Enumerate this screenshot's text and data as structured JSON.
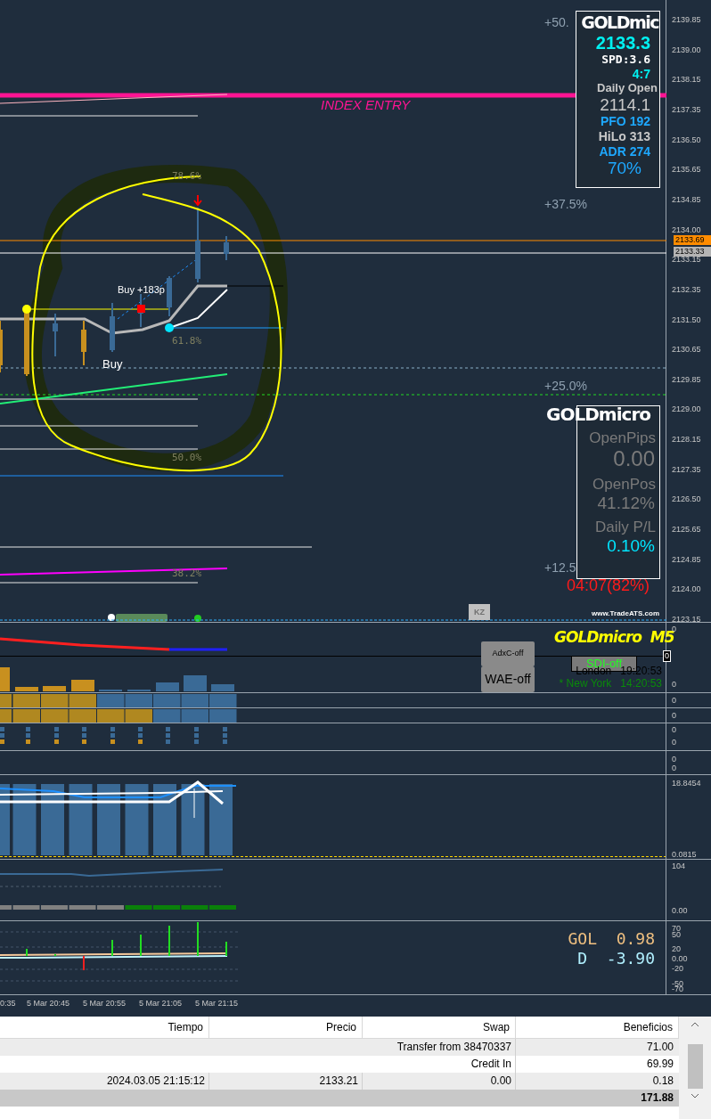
{
  "main_chart": {
    "fib_labels": [
      "+50.",
      "+37.5%",
      "+25.0%",
      "+12.5"
    ],
    "level_labels": [
      "78.6%",
      "61.8%",
      "50.0%",
      "38.2%"
    ],
    "index_entry": "INDEX ENTRY",
    "trade_labels": [
      "Buy +183p",
      "Buy"
    ],
    "countdown": "04:07(82%)",
    "website": "www.TradeATS.com",
    "kz_button": "KZ",
    "price_axis": [
      "2139.85",
      "2139.00",
      "2138.15",
      "2137.35",
      "2136.50",
      "2135.65",
      "2134.85",
      "2134.00",
      "2133.15",
      "2132.35",
      "2131.50",
      "2130.65",
      "2129.85",
      "2129.00",
      "2128.15",
      "2127.35",
      "2126.50",
      "2125.65",
      "2124.85",
      "2124.00",
      "2123.15"
    ],
    "price_tags": [
      {
        "text": "2133.69",
        "color": "#ff8c00"
      },
      {
        "text": "2133.33",
        "color": "#b4b4b4"
      }
    ]
  },
  "info_panel": {
    "symbol": "GOLDmic",
    "price": "2133.3",
    "spread": "SPD:3.6",
    "ratio": "4:7",
    "daily_open_label": "Daily Open",
    "daily_open": "2114.1",
    "pfo": "PFO 192",
    "hilo": "HiLo 313",
    "adr": "ADR 274",
    "adr_percent": "70%"
  },
  "position_panel": {
    "symbol": "GOLDmicro",
    "rows": [
      {
        "label": "OpenPips",
        "value": "0.00",
        "color": "#7a7a7a"
      },
      {
        "label": "OpenPos",
        "value": "41.12%",
        "color": "#7a7a7a"
      },
      {
        "label": "Daily P/L",
        "value": "0.10%",
        "color": "#00e5ff"
      }
    ]
  },
  "indicator_pane": {
    "title": "GOLDmicro  M5",
    "buttons": [
      {
        "label": "AdxC-off",
        "kind": "plain"
      },
      {
        "label": "WAE-off",
        "kind": "plain"
      },
      {
        "label": "SDI-off",
        "kind": "toggle"
      }
    ],
    "clocks": [
      {
        "city": "London",
        "time": "19:20:53",
        "color": "#000000"
      },
      {
        "city": "* New York",
        "time": "14:20:53",
        "color": "#0a8a0a"
      }
    ],
    "axis": [
      "0",
      "0"
    ],
    "zero_marker": "0"
  },
  "pane_3": {
    "axis": [
      "0"
    ]
  },
  "pane_4": {
    "axis": [
      "0"
    ]
  },
  "pane_5": {
    "axis": [
      "0",
      "0"
    ]
  },
  "pane_6": {
    "axis": [
      "0",
      "0"
    ]
  },
  "pane_7": {
    "axis": [
      "18.8454",
      "0.0815"
    ]
  },
  "pane_8": {
    "axis": [
      "104",
      "0.00"
    ]
  },
  "pane_9": {
    "axis": [
      "70",
      "50",
      "20",
      "0.00",
      "-20",
      "-50",
      "-70"
    ],
    "readouts": [
      {
        "label": "GOL",
        "value": "0.98",
        "color": "#f0c080"
      },
      {
        "label": "D",
        "value": "-3.90",
        "color": "#b0f0ff"
      }
    ]
  },
  "time_axis": [
    "0:35",
    "5 Mar 20:45",
    "5 Mar 20:55",
    "5 Mar 21:05",
    "5 Mar 21:15"
  ],
  "table": {
    "columns": [
      "Tiempo",
      "Precio",
      "Swap",
      "Beneficios"
    ],
    "rows": [
      {
        "comment": "Transfer from 38470337",
        "profit": "71.00"
      },
      {
        "comment": "Credit In",
        "profit": "69.99"
      },
      {
        "time": "2024.03.05 21:15:12",
        "price": "2133.21",
        "swap": "0.00",
        "profit": "0.18"
      }
    ],
    "total": "171.88"
  }
}
